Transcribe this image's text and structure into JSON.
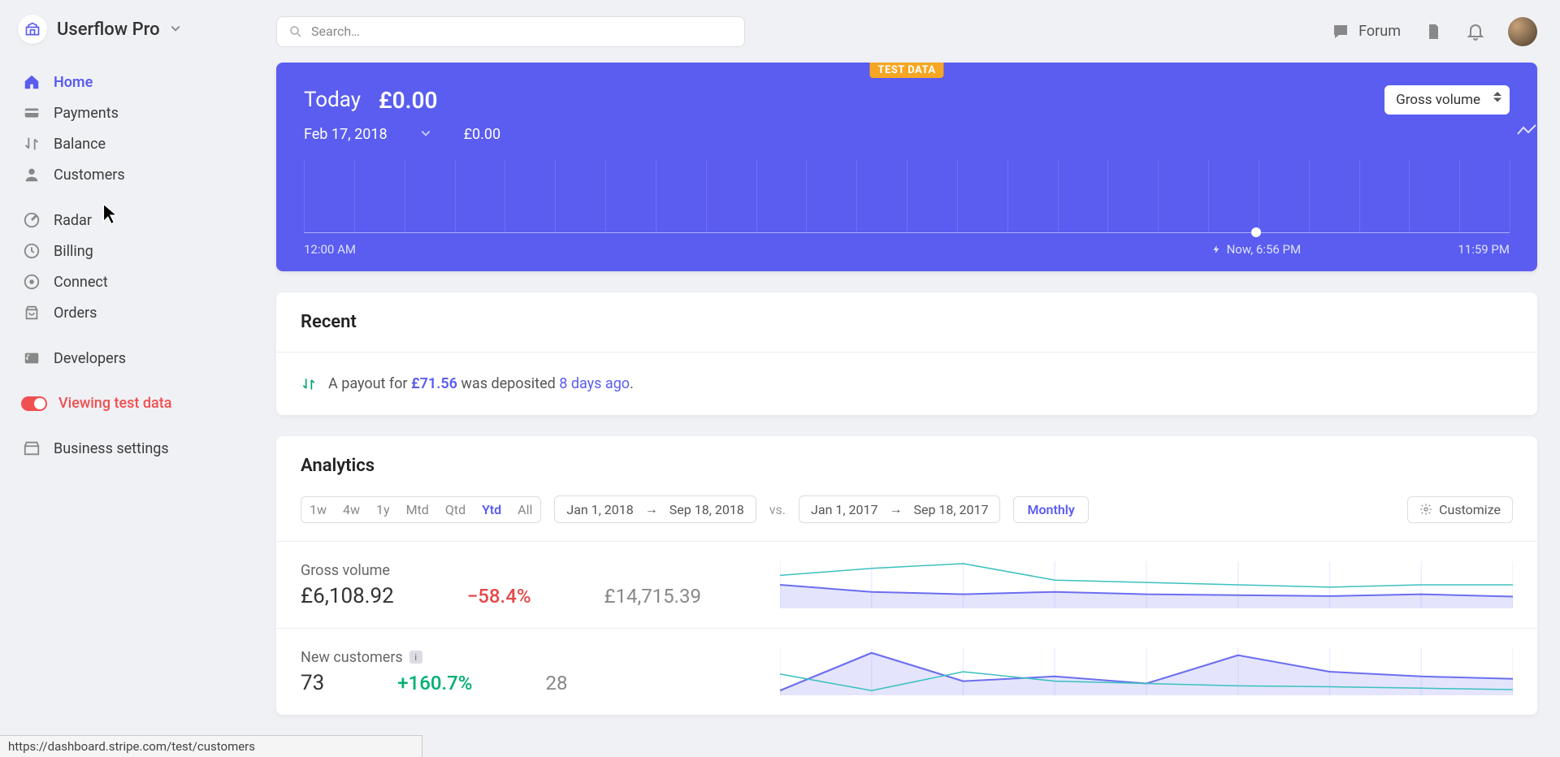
{
  "app": {
    "name": "Userflow Pro"
  },
  "header": {
    "search_placeholder": "Search…",
    "forum": "Forum"
  },
  "sidebar": {
    "items": [
      {
        "label": "Home",
        "icon": "home-icon",
        "active": true
      },
      {
        "label": "Payments",
        "icon": "payments-icon",
        "active": false
      },
      {
        "label": "Balance",
        "icon": "balance-icon",
        "active": false
      },
      {
        "label": "Customers",
        "icon": "customers-icon",
        "active": false
      },
      {
        "label": "Radar",
        "icon": "radar-icon",
        "active": false
      },
      {
        "label": "Billing",
        "icon": "billing-icon",
        "active": false
      },
      {
        "label": "Connect",
        "icon": "connect-icon",
        "active": false
      },
      {
        "label": "Orders",
        "icon": "orders-icon",
        "active": false
      },
      {
        "label": "Developers",
        "icon": "developers-icon",
        "active": false
      }
    ],
    "test_data_label": "Viewing test data",
    "business_settings": "Business settings"
  },
  "today": {
    "test_badge": "TEST DATA",
    "label": "Today",
    "value": "£0.00",
    "date": "Feb 17, 2018",
    "prev_value": "£0.00",
    "selector": "Gross volume",
    "axis_start": "12:00 AM",
    "axis_now": "Now, 6:56 PM",
    "axis_end": "11:59 PM",
    "now_fraction": 0.79
  },
  "recent": {
    "title": "Recent",
    "item": {
      "pre": "A payout for ",
      "amount": "£71.56",
      "mid": " was deposited ",
      "when": "8 days ago",
      "post": "."
    }
  },
  "analytics": {
    "title": "Analytics",
    "segments": [
      "1w",
      "4w",
      "1y",
      "Mtd",
      "Qtd",
      "Ytd",
      "All"
    ],
    "active_segment": "Ytd",
    "range1_from": "Jan 1, 2018",
    "range1_to": "Sep 18, 2018",
    "vs": "vs.",
    "range2_from": "Jan 1, 2017",
    "range2_to": "Sep 18, 2017",
    "period": "Monthly",
    "customize": "Customize",
    "rows": [
      {
        "name": "Gross volume",
        "value": "£6,108.92",
        "delta": "−58.4%",
        "delta_dir": "down",
        "compare": "£14,715.39"
      },
      {
        "name": "New customers",
        "value": "73",
        "delta": "+160.7%",
        "delta_dir": "up",
        "compare": "28"
      }
    ]
  },
  "chart_data": [
    {
      "type": "line",
      "title": "Gross volume",
      "series": [
        {
          "name": "2018",
          "values": [
            0.5,
            0.35,
            0.3,
            0.35,
            0.3,
            0.28,
            0.26,
            0.3,
            0.25
          ]
        },
        {
          "name": "2017",
          "values": [
            0.7,
            0.85,
            0.95,
            0.6,
            0.55,
            0.5,
            0.45,
            0.5,
            0.5
          ]
        }
      ],
      "ylim": [
        0,
        1
      ]
    },
    {
      "type": "line",
      "title": "New customers",
      "series": [
        {
          "name": "2018",
          "values": [
            0.1,
            0.9,
            0.3,
            0.4,
            0.25,
            0.85,
            0.5,
            0.4,
            0.35
          ]
        },
        {
          "name": "2017",
          "values": [
            0.45,
            0.1,
            0.5,
            0.3,
            0.25,
            0.2,
            0.18,
            0.15,
            0.12
          ]
        }
      ],
      "ylim": [
        0,
        1
      ]
    }
  ],
  "statusbar": {
    "url": "https://dashboard.stripe.com/test/customers"
  }
}
